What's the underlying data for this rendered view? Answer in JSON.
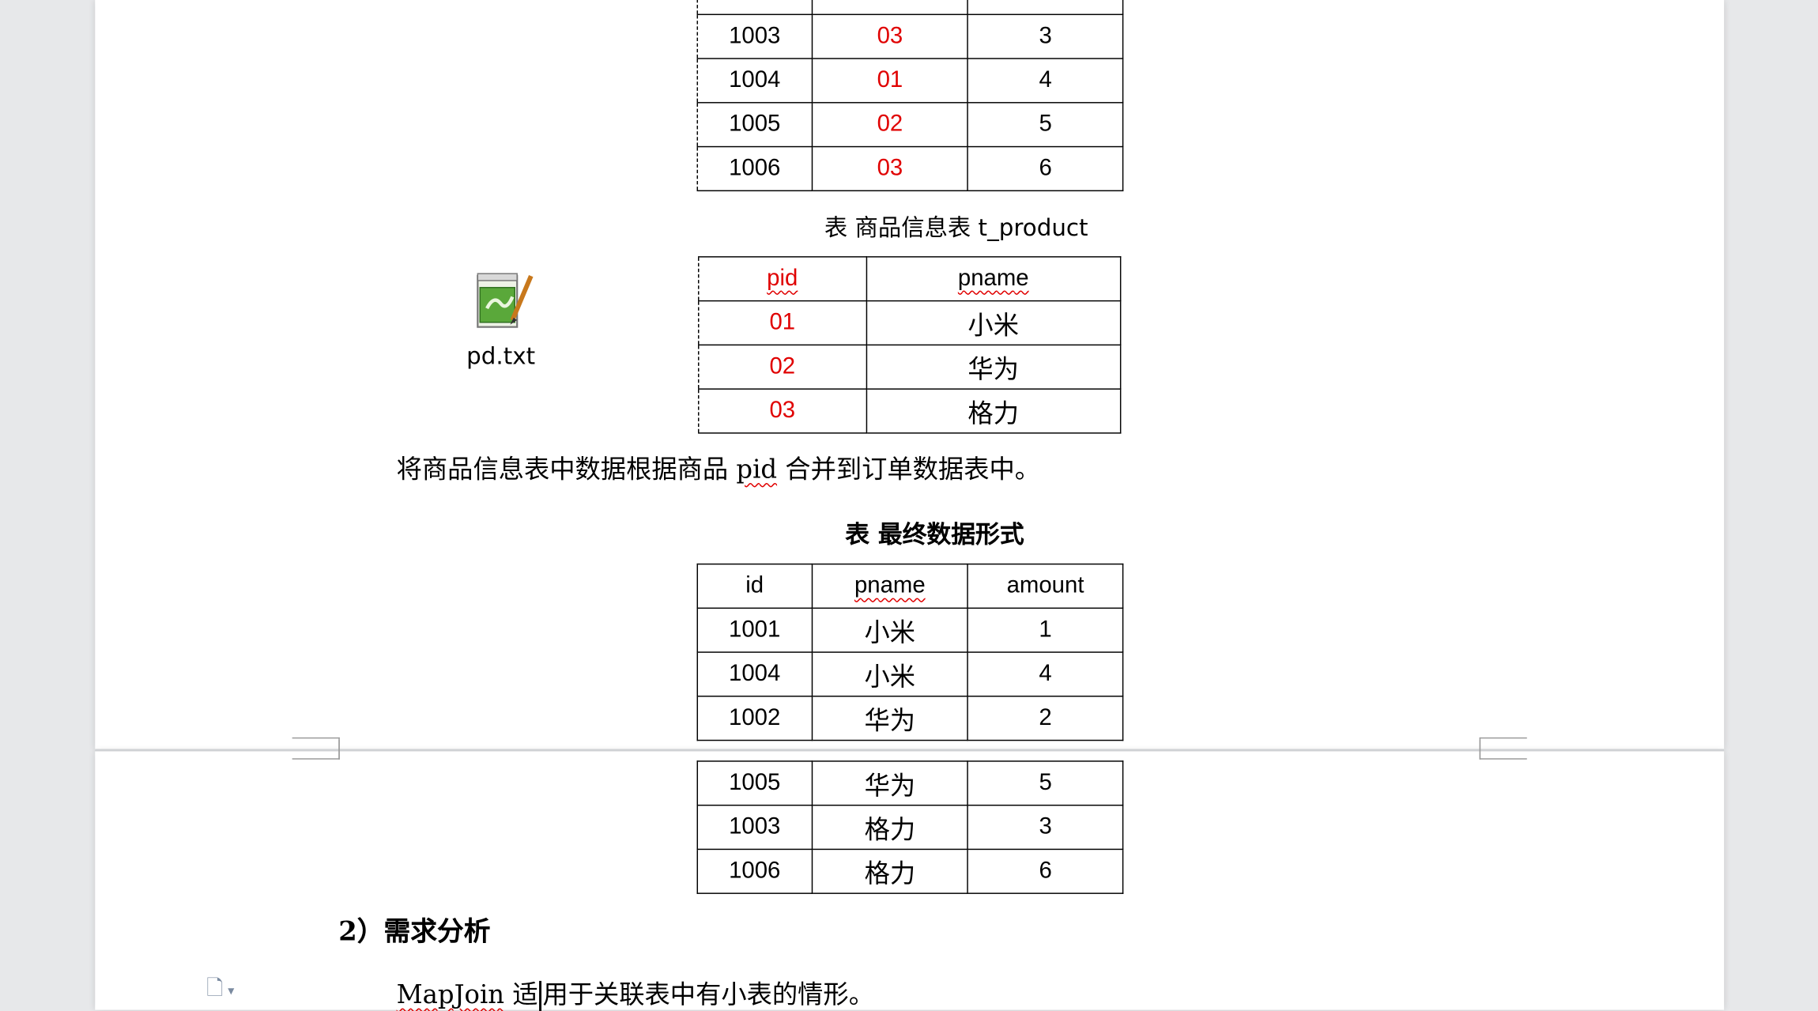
{
  "top_table": {
    "rows": [
      [
        "1003",
        "03",
        "3"
      ],
      [
        "1004",
        "01",
        "4"
      ],
      [
        "1005",
        "02",
        "5"
      ],
      [
        "1006",
        "03",
        "6"
      ]
    ]
  },
  "product_table": {
    "caption": "表 商品信息表 t_product",
    "header": [
      "pid",
      "pname"
    ],
    "rows": [
      [
        "01",
        "小米"
      ],
      [
        "02",
        "华为"
      ],
      [
        "03",
        "格力"
      ]
    ]
  },
  "file_icon": {
    "icon": "notepad-file-icon",
    "label": "pd.txt"
  },
  "merge_sentence": {
    "before": "将商品信息表中数据根据商品 ",
    "keyword": "pid",
    "after": " 合并到订单数据表中。"
  },
  "final_table": {
    "caption": "表 最终数据形式",
    "header": [
      "id",
      "pname",
      "amount"
    ],
    "rows_page1": [
      [
        "1001",
        "小米",
        "1"
      ],
      [
        "1004",
        "小米",
        "4"
      ],
      [
        "1002",
        "华为",
        "2"
      ]
    ],
    "rows_page2": [
      [
        "1005",
        "华为",
        "5"
      ],
      [
        "1003",
        "格力",
        "3"
      ],
      [
        "1006",
        "格力",
        "6"
      ]
    ]
  },
  "section_heading": "2）需求分析",
  "mapjoin_sentence": {
    "keyword": "MapJoin",
    "text_a": " 适",
    "text_b": "用于关联表中有小表的情形。"
  },
  "left_margin_icon": "document-options-icon",
  "colors": {
    "red_text": "#e00000",
    "page_bg": "#ffffff",
    "canvas_bg": "#e7e8ea"
  }
}
